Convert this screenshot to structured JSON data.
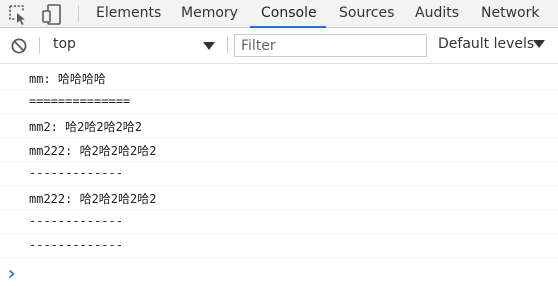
{
  "tabs": [
    {
      "label": "Elements"
    },
    {
      "label": "Memory"
    },
    {
      "label": "Console"
    },
    {
      "label": "Sources"
    },
    {
      "label": "Audits"
    },
    {
      "label": "Network"
    }
  ],
  "active_tab": "Console",
  "toolbar": {
    "context_value": "top",
    "filter_placeholder": "Filter",
    "levels_label": "Default levels"
  },
  "icons": {
    "inspect": "inspect-element-icon",
    "device": "device-toolbar-icon",
    "clear": "clear-console-icon",
    "context_caret": "chevron-down-icon",
    "levels_caret": "chevron-down-icon",
    "prompt": "chevron-right-icon"
  },
  "colors": {
    "active_tab_underline": "#1a73e8",
    "prompt": "#1a73e8"
  },
  "messages": [
    {
      "text": "mm: 哈哈哈哈"
    },
    {
      "text": "=============="
    },
    {
      "text": "mm2: 哈2哈2哈2哈2"
    },
    {
      "text": "mm222: 哈2哈2哈2哈2"
    },
    {
      "text": "-------------"
    },
    {
      "text": "mm222: 哈2哈2哈2哈2"
    },
    {
      "text": "-------------"
    },
    {
      "text": "-------------"
    }
  ]
}
